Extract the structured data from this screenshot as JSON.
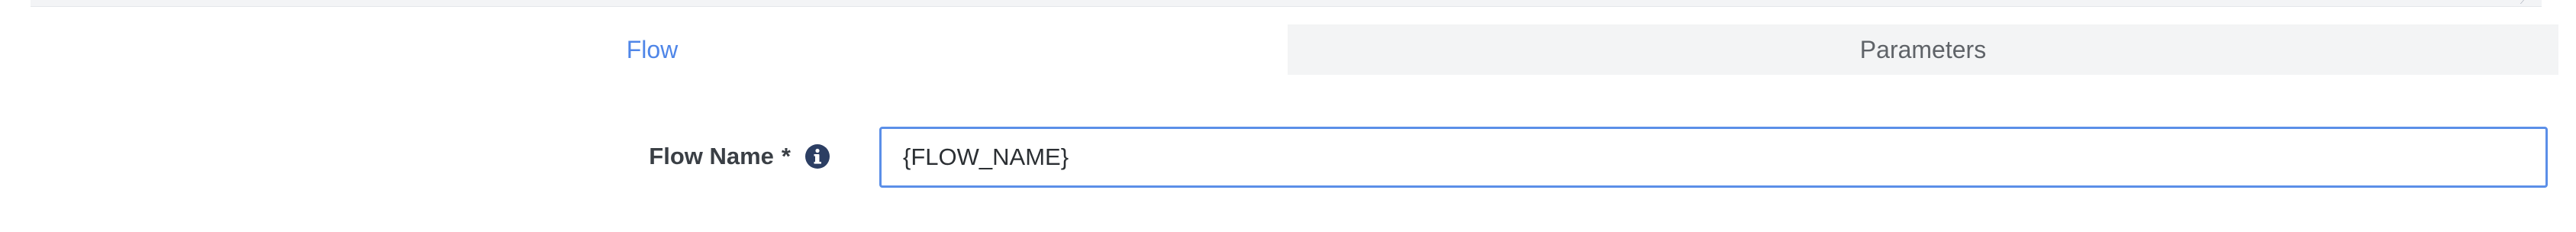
{
  "tabs": [
    {
      "label": "Flow",
      "active": true
    },
    {
      "label": "Parameters",
      "active": false
    }
  ],
  "form": {
    "flow_name": {
      "label": "Flow Name",
      "required_marker": "*",
      "info_icon": "info-circle-icon",
      "value": "{FLOW_NAME}"
    }
  },
  "colors": {
    "accent": "#4f86e8",
    "input_border": "#5b8fe8",
    "info_icon": "#2c3e63",
    "tab_inactive_bg": "#f3f4f5"
  }
}
